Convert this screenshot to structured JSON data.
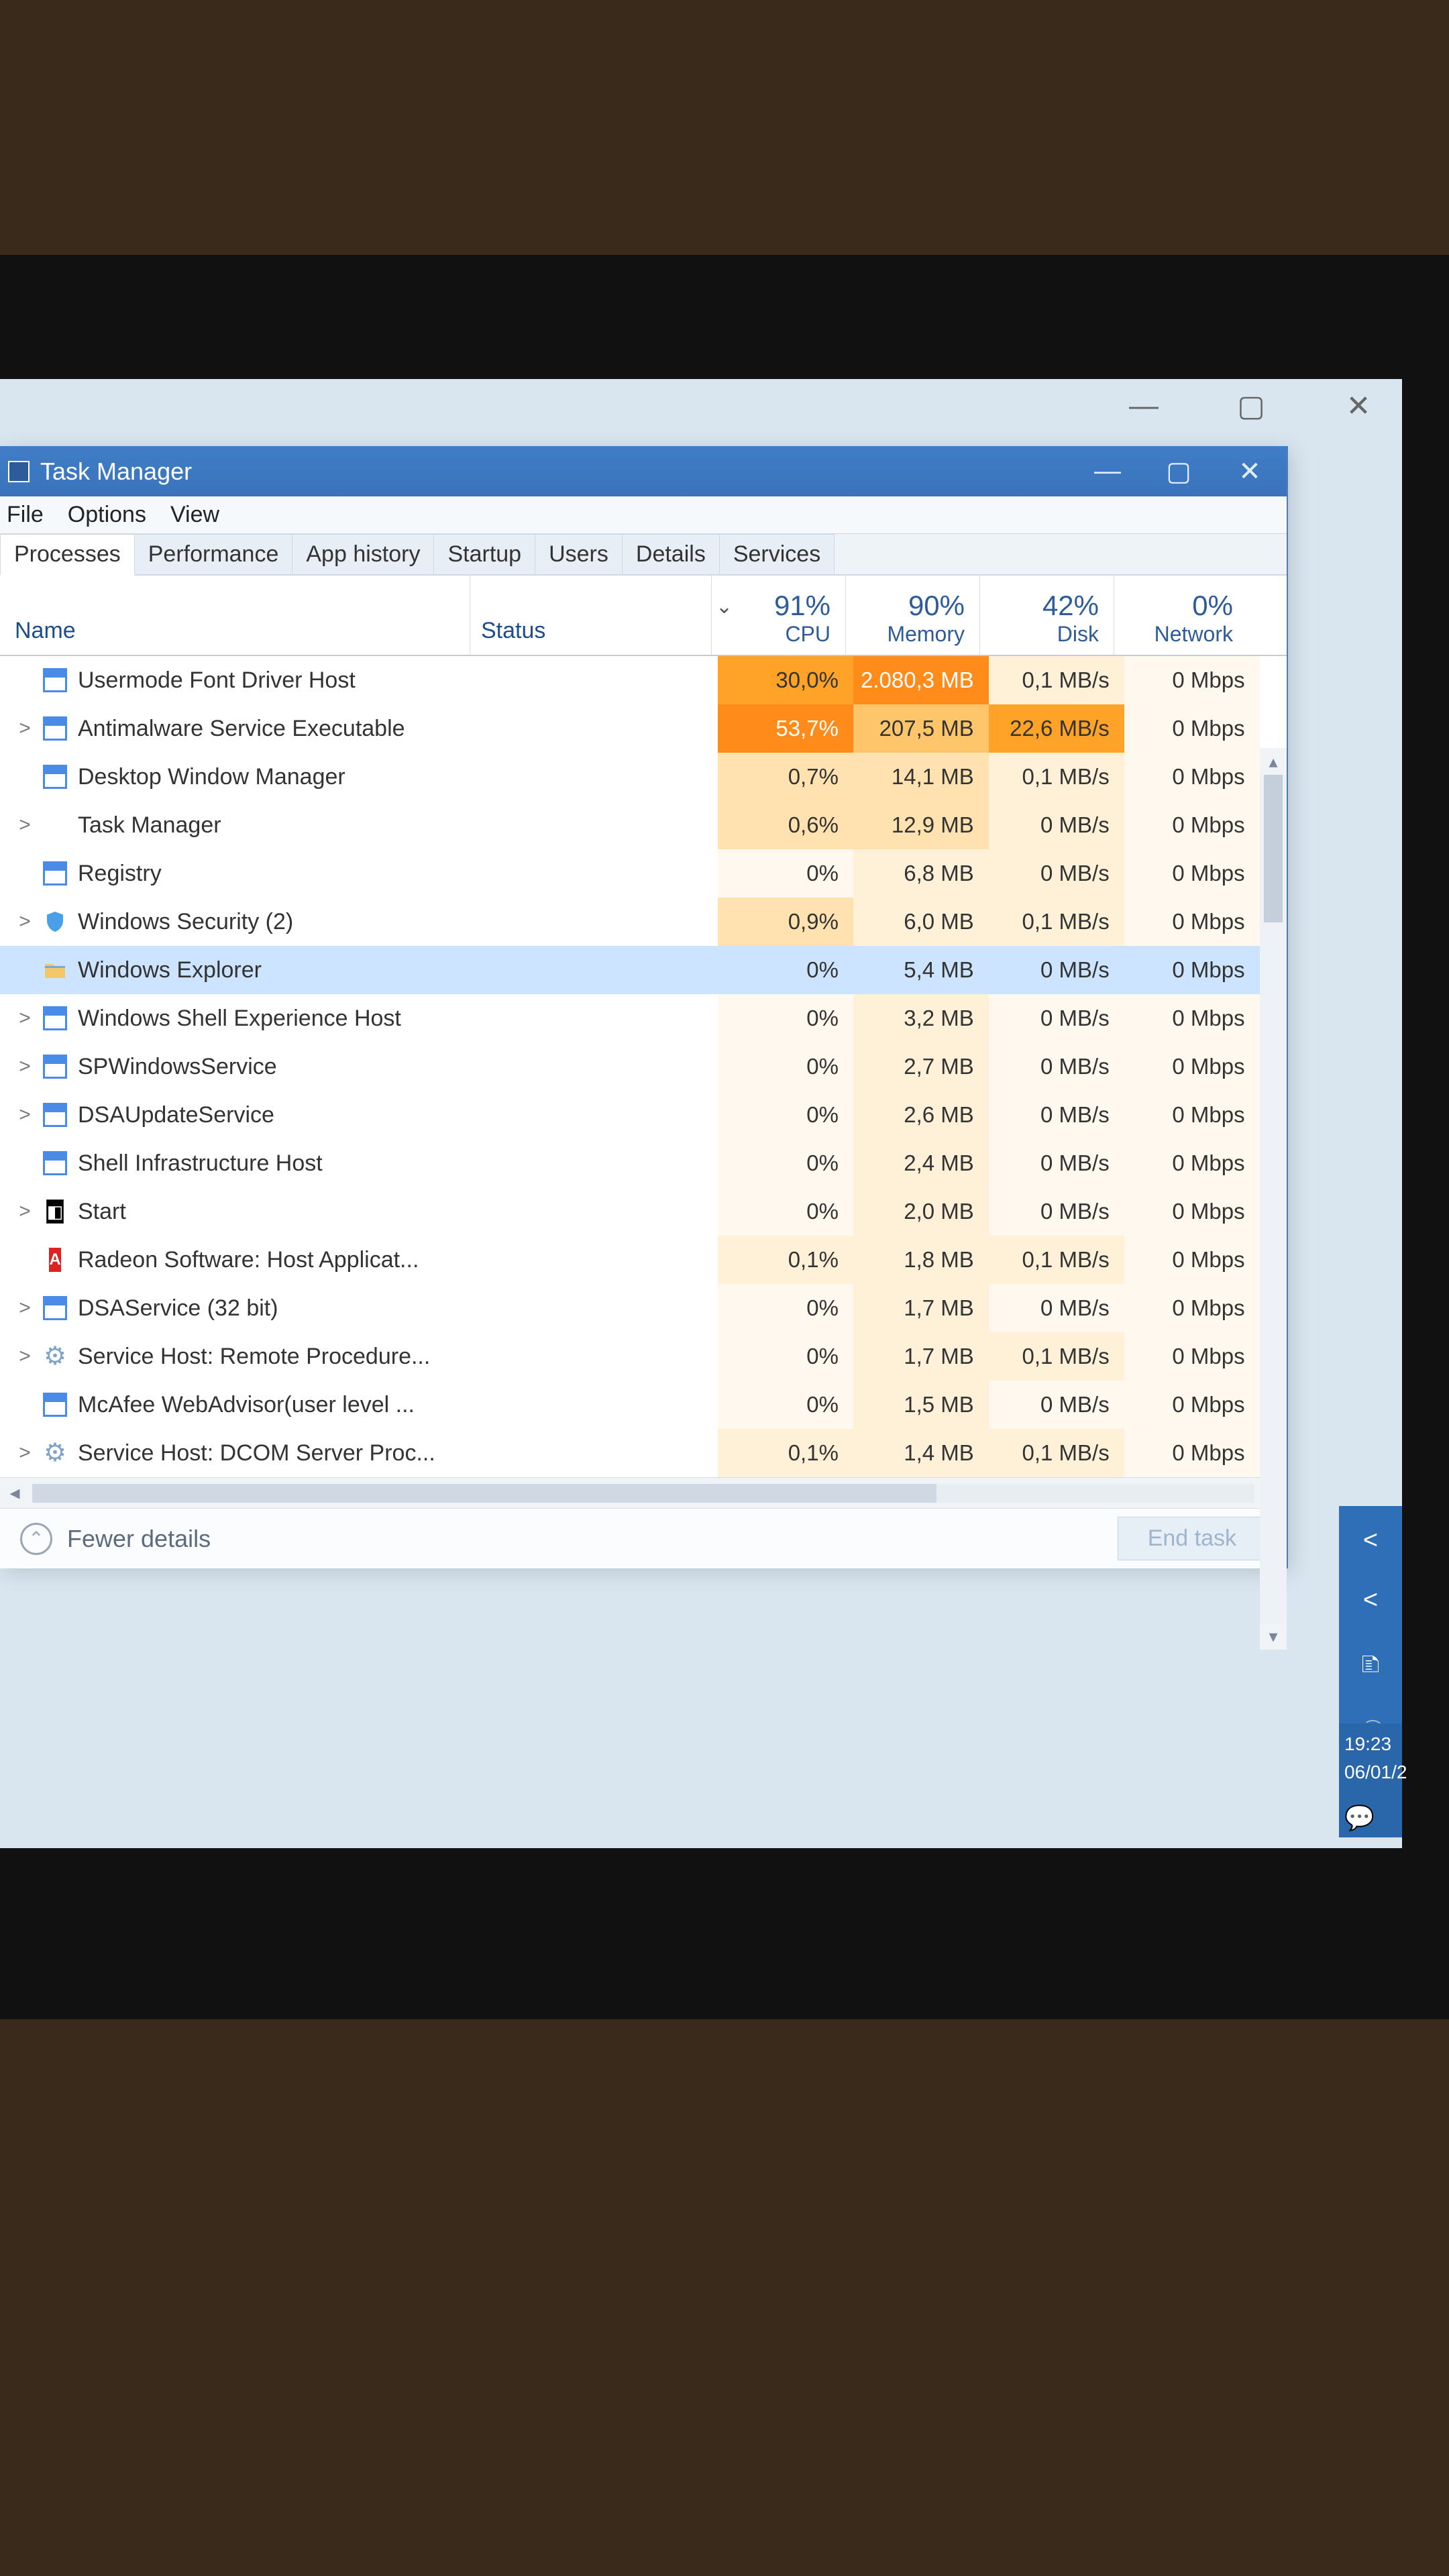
{
  "window": {
    "title": "Task Manager",
    "menu": [
      "File",
      "Options",
      "View"
    ],
    "tabs": [
      "Processes",
      "Performance",
      "App history",
      "Startup",
      "Users",
      "Details",
      "Services"
    ],
    "active_tab": "Processes"
  },
  "columns": {
    "name": "Name",
    "status": "Status",
    "cpu": {
      "pct": "91%",
      "label": "CPU"
    },
    "memory": {
      "pct": "90%",
      "label": "Memory"
    },
    "disk": {
      "pct": "42%",
      "label": "Disk"
    },
    "network": {
      "pct": "0%",
      "label": "Network"
    }
  },
  "processes": [
    {
      "exp": "",
      "icon": "window",
      "name": "Usermode Font Driver Host",
      "cpu": "30,0%",
      "cpu_h": "h4",
      "mem": "2.080,3 MB",
      "mem_h": "h5",
      "disk": "0,1 MB/s",
      "disk_h": "h1",
      "net": "0 Mbps"
    },
    {
      "exp": ">",
      "icon": "window",
      "name": "Antimalware Service Executable",
      "cpu": "53,7%",
      "cpu_h": "h5",
      "mem": "207,5 MB",
      "mem_h": "h3",
      "disk": "22,6 MB/s",
      "disk_h": "h4",
      "net": "0 Mbps"
    },
    {
      "exp": "",
      "icon": "window",
      "name": "Desktop Window Manager",
      "cpu": "0,7%",
      "cpu_h": "h2",
      "mem": "14,1 MB",
      "mem_h": "h2",
      "disk": "0,1 MB/s",
      "disk_h": "h1",
      "net": "0 Mbps"
    },
    {
      "exp": ">",
      "icon": "tm",
      "name": "Task Manager",
      "cpu": "0,6%",
      "cpu_h": "h2",
      "mem": "12,9 MB",
      "mem_h": "h2",
      "disk": "0 MB/s",
      "disk_h": "h1",
      "net": "0 Mbps"
    },
    {
      "exp": "",
      "icon": "window",
      "name": "Registry",
      "cpu": "0%",
      "cpu_h": "h0",
      "mem": "6,8 MB",
      "mem_h": "h1",
      "disk": "0 MB/s",
      "disk_h": "h1",
      "net": "0 Mbps"
    },
    {
      "exp": ">",
      "icon": "shield",
      "name": "Windows Security (2)",
      "cpu": "0,9%",
      "cpu_h": "h2",
      "mem": "6,0 MB",
      "mem_h": "h1",
      "disk": "0,1 MB/s",
      "disk_h": "h1",
      "net": "0 Mbps"
    },
    {
      "exp": "",
      "icon": "explorer",
      "name": "Windows Explorer",
      "cpu": "0%",
      "cpu_h": "h0",
      "mem": "5,4 MB",
      "mem_h": "h1",
      "disk": "0 MB/s",
      "disk_h": "h1",
      "net": "0 Mbps",
      "selected": true
    },
    {
      "exp": ">",
      "icon": "window",
      "name": "Windows Shell Experience Host",
      "cpu": "0%",
      "cpu_h": "h0",
      "mem": "3,2 MB",
      "mem_h": "h1",
      "disk": "0 MB/s",
      "disk_h": "h0",
      "net": "0 Mbps"
    },
    {
      "exp": ">",
      "icon": "window",
      "name": "SPWindowsService",
      "cpu": "0%",
      "cpu_h": "h0",
      "mem": "2,7 MB",
      "mem_h": "h1",
      "disk": "0 MB/s",
      "disk_h": "h0",
      "net": "0 Mbps"
    },
    {
      "exp": ">",
      "icon": "window",
      "name": "DSAUpdateService",
      "cpu": "0%",
      "cpu_h": "h0",
      "mem": "2,6 MB",
      "mem_h": "h1",
      "disk": "0 MB/s",
      "disk_h": "h0",
      "net": "0 Mbps"
    },
    {
      "exp": "",
      "icon": "window",
      "name": "Shell Infrastructure Host",
      "cpu": "0%",
      "cpu_h": "h0",
      "mem": "2,4 MB",
      "mem_h": "h1",
      "disk": "0 MB/s",
      "disk_h": "h0",
      "net": "0 Mbps"
    },
    {
      "exp": ">",
      "icon": "start",
      "name": "Start",
      "cpu": "0%",
      "cpu_h": "h0",
      "mem": "2,0 MB",
      "mem_h": "h1",
      "disk": "0 MB/s",
      "disk_h": "h0",
      "net": "0 Mbps"
    },
    {
      "exp": "",
      "icon": "amd",
      "name": "Radeon Software: Host Applicat...",
      "cpu": "0,1%",
      "cpu_h": "h1",
      "mem": "1,8 MB",
      "mem_h": "h1",
      "disk": "0,1 MB/s",
      "disk_h": "h1",
      "net": "0 Mbps"
    },
    {
      "exp": ">",
      "icon": "window",
      "name": "DSAService (32 bit)",
      "cpu": "0%",
      "cpu_h": "h0",
      "mem": "1,7 MB",
      "mem_h": "h1",
      "disk": "0 MB/s",
      "disk_h": "h0",
      "net": "0 Mbps"
    },
    {
      "exp": ">",
      "icon": "gear",
      "name": "Service Host: Remote Procedure...",
      "cpu": "0%",
      "cpu_h": "h0",
      "mem": "1,7 MB",
      "mem_h": "h1",
      "disk": "0,1 MB/s",
      "disk_h": "h1",
      "net": "0 Mbps"
    },
    {
      "exp": "",
      "icon": "window",
      "name": "McAfee WebAdvisor(user level ...",
      "cpu": "0%",
      "cpu_h": "h0",
      "mem": "1,5 MB",
      "mem_h": "h1",
      "disk": "0 MB/s",
      "disk_h": "h0",
      "net": "0 Mbps"
    },
    {
      "exp": ">",
      "icon": "gear",
      "name": "Service Host: DCOM Server Proc...",
      "cpu": "0,1%",
      "cpu_h": "h1",
      "mem": "1,4 MB",
      "mem_h": "h1",
      "disk": "0,1 MB/s",
      "disk_h": "h1",
      "net": "0 Mbps"
    }
  ],
  "footer": {
    "fewer": "Fewer details",
    "end_task": "End task"
  },
  "systray": {
    "time": "19:23",
    "date": "06/01/2"
  }
}
